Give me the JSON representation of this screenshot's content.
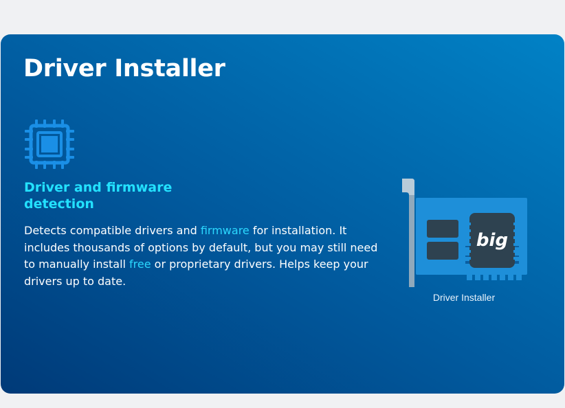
{
  "page": {
    "title": "Driver Installer"
  },
  "feature": {
    "icon": "cpu-chip-icon",
    "heading": "Driver and firmware detection",
    "description": {
      "part1": "Detects compatible drivers and ",
      "link1": "firmware",
      "part2": " for installation. It includes thousands of options by default, but you may still need to manually install ",
      "link2": "free",
      "part3": " or proprietary drivers. Helps keep your drivers up to date."
    }
  },
  "illustration": {
    "icon": "expansion-card-icon",
    "chip_label": "big",
    "caption": "Driver Installer"
  },
  "colors": {
    "card_gradient_start": "#003a78",
    "card_gradient_end": "#0182c6",
    "accent_cyan": "#23e1ff",
    "chip_blue": "#1a8fe6"
  }
}
